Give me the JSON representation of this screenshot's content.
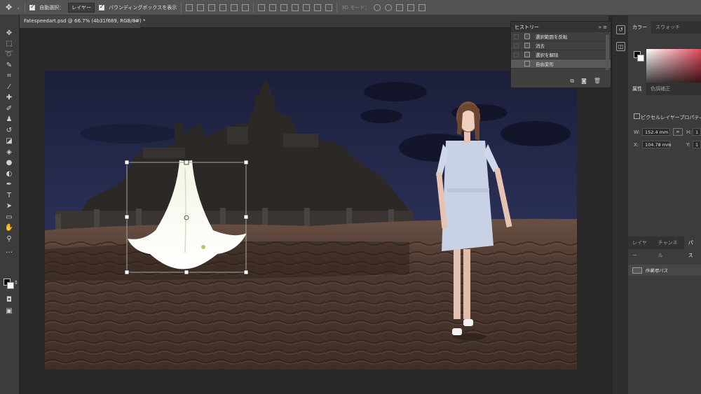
{
  "options_bar": {
    "auto_select_label": "自動選択：",
    "auto_select_target": "レイヤー",
    "bounding_box_label": "バウンディングボックスを表示",
    "mode_3d_label": "3D モード："
  },
  "document": {
    "tab_title": "Fatespeedart.psd @ 66.7% (4b31f689, RGB/8#) *",
    "close_symbol": "×"
  },
  "history": {
    "title": "ヒストリー",
    "controls": "»  ≡",
    "items": [
      {
        "label": "選択範囲を反転"
      },
      {
        "label": "消去"
      },
      {
        "label": "選択を解除"
      },
      {
        "label": "自由変形"
      }
    ]
  },
  "color_panel": {
    "tabs": [
      "カラー",
      "スウォッチ"
    ],
    "foreground": "#000000",
    "background": "#ffffff",
    "accent_hue": "#e34a5a"
  },
  "properties": {
    "tabs": [
      "属性",
      "色調補正"
    ],
    "layer_type": "ピクセルレイヤープロパティ",
    "w_label": "W:",
    "w_value": "152.4 mm",
    "h_label": "H:",
    "h_value": "1",
    "x_label": "X:",
    "x_value": "104.78 mm",
    "y_label": "Y:",
    "y_value": "1",
    "link_symbol": "∞"
  },
  "layers_panel": {
    "tabs": [
      "レイヤー",
      "チャンネル",
      "パス"
    ],
    "path_item": "作業用パス"
  },
  "dock_icons": [
    "history-icon",
    "properties-icon"
  ],
  "colors": {
    "ui_dark": "#282828",
    "panel": "#3c3c3c",
    "sky_top": "#1b1f3a",
    "sand": "#5a4438"
  }
}
